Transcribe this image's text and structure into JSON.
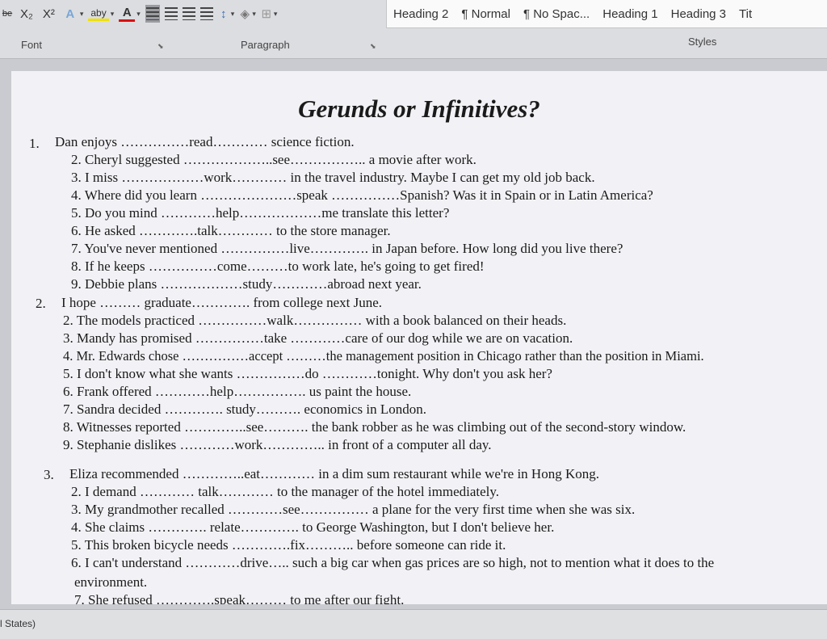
{
  "ribbon": {
    "font_group_label": "Font",
    "paragraph_group_label": "Paragraph",
    "styles_group_label": "Styles",
    "styles": [
      "Heading 2",
      "¶ Normal",
      "¶ No Spac...",
      "Heading 1",
      "Heading 3",
      "Tit"
    ],
    "subscript": "X₂",
    "superscript": "X²",
    "highlight_label": "aby",
    "font_color_label": "A",
    "text_effects_label": "A"
  },
  "document": {
    "title": "Gerunds or Infinitives?",
    "lines": [
      {
        "num": "1.",
        "text": "Dan enjoys ……………read………… science fiction."
      },
      {
        "text": "2. Cheryl suggested ………………..see…………….. a movie after work."
      },
      {
        "text": "3. I miss ………………work………… in the travel industry. Maybe I can get my old job back."
      },
      {
        "text": "4. Where did you learn …………………speak ……………Spanish? Was it in Spain or in Latin America?"
      },
      {
        "text": "5. Do you mind …………help………………me translate this letter?"
      },
      {
        "text": "6. He asked ………….talk………… to the store manager."
      },
      {
        "text": "7. You've never mentioned ……………live…………. in Japan before. How long did you live there?"
      },
      {
        "text": "8. If he keeps ……………come………to work late, he's going to get fired!"
      },
      {
        "text": "9. Debbie plans ………………study…………abroad next year."
      },
      {
        "num": "2.",
        "text": "I hope ……… graduate…………. from college next June."
      },
      {
        "text": "2. The models practiced ……………walk…………… with a book balanced on their heads."
      },
      {
        "text": "3. Mandy has promised ……………take …………care of our dog while we are on vacation."
      },
      {
        "text": "4. Mr. Edwards chose ……………accept ………the management position in Chicago rather than the position in Miami."
      },
      {
        "text": "5. I don't know what she wants ……………do …………tonight. Why don't you ask her?"
      },
      {
        "text": "6. Frank offered …………help……………. us paint the house."
      },
      {
        "text": "7. Sandra decided …………. study………. economics in London."
      },
      {
        "text": "8. Witnesses reported …………..see………. the bank robber as he was climbing out of the second-story window."
      },
      {
        "text": "9. Stephanie dislikes …………work………….. in front of a computer all day."
      },
      {
        "num": "3.",
        "text": "Eliza recommended …………..eat………… in a dim sum restaurant while we're in Hong Kong."
      },
      {
        "text": "2. I demand ………… talk………… to the manager of the hotel immediately."
      },
      {
        "text": "3. My grandmother recalled …………see…………… a plane for the very first time when she was six."
      },
      {
        "text": "4. She claims …………. relate…………. to George Washington, but I don't believe her."
      },
      {
        "text": "5. This broken bicycle needs ………….fix……….. before someone can ride it."
      },
      {
        "text": "6. I can't understand …………drive….. such a big car when gas prices are so high, not to mention what it does to the"
      },
      {
        "text": "environment."
      },
      {
        "text": "7. She refused ………….speak……… to me after our fight."
      }
    ]
  },
  "statusbar": {
    "language_fragment": "l States)"
  }
}
